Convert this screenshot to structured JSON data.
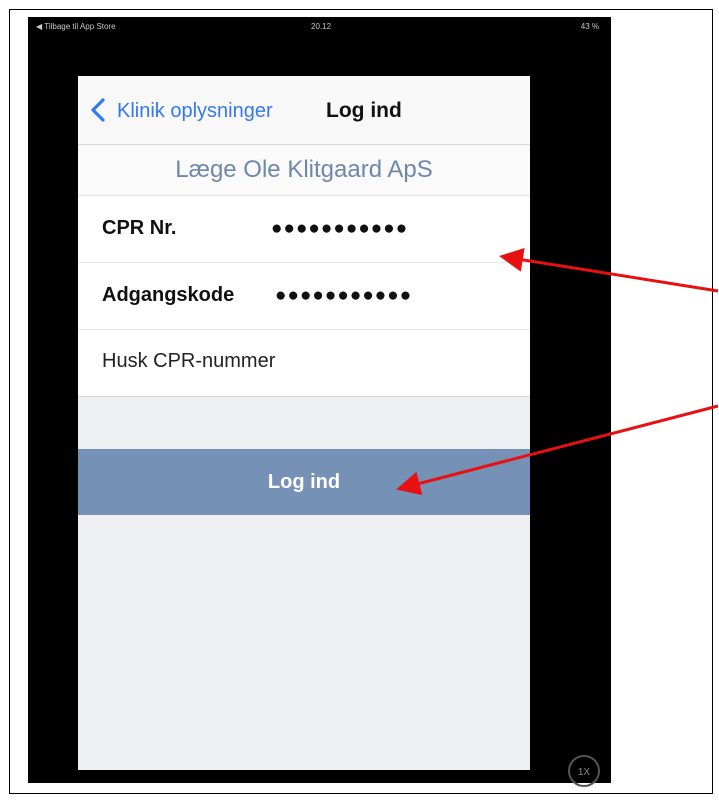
{
  "status_bar": {
    "left_text": "◀ Tilbage til App Store",
    "time": "20.12",
    "right_text": "43 %"
  },
  "navbar": {
    "back_label": "Klinik oplysninger",
    "title": "Log ind"
  },
  "clinic_name": "Læge Ole Klitgaard ApS",
  "form": {
    "cpr_label": "CPR Nr.",
    "cpr_value": "●●●●●●●●●●●",
    "password_label": "Adgangskode",
    "password_value": "●●●●●●●●●●●",
    "remember_label": "Husk CPR-nummer"
  },
  "login_button_label": "Log ind",
  "zoom_badge": "1X",
  "colors": {
    "accent_blue": "#3478f6",
    "clinic_text": "#7088a8",
    "button_bg": "#7591b5",
    "annotation_arrow": "#e81010"
  }
}
